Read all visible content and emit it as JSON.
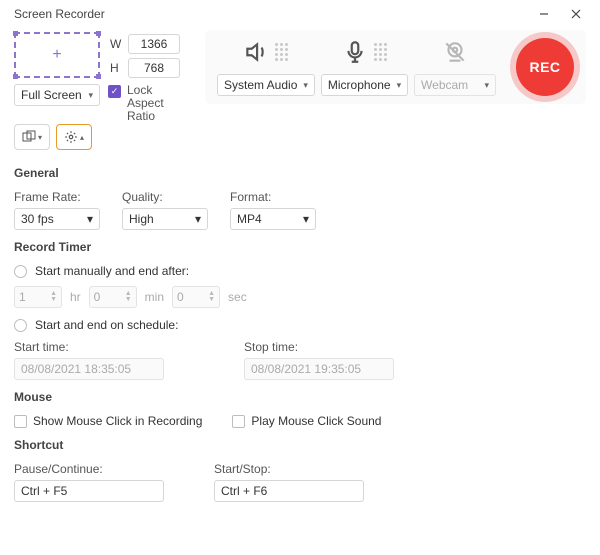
{
  "window": {
    "title": "Screen Recorder"
  },
  "capture": {
    "width": "1366",
    "height": "768",
    "width_label": "W",
    "height_label": "H",
    "mode": "Full Screen",
    "lock_aspect": "Lock Aspect Ratio"
  },
  "devices": {
    "system_audio": "System Audio",
    "microphone": "Microphone",
    "webcam": "Webcam"
  },
  "record_button": "REC",
  "sections": {
    "general": "General",
    "record_timer": "Record Timer",
    "mouse": "Mouse",
    "shortcut": "Shortcut"
  },
  "general": {
    "frame_rate_label": "Frame Rate:",
    "frame_rate_value": "30 fps",
    "quality_label": "Quality:",
    "quality_value": "High",
    "format_label": "Format:",
    "format_value": "MP4"
  },
  "timer": {
    "opt_manual": "Start manually and end after:",
    "opt_schedule": "Start and end on schedule:",
    "hr_value": "1",
    "hr_unit": "hr",
    "min_value": "0",
    "min_unit": "min",
    "sec_value": "0",
    "sec_unit": "sec",
    "start_label": "Start time:",
    "stop_label": "Stop time:",
    "start_value": "08/08/2021 18:35:05",
    "stop_value": "08/08/2021 19:35:05"
  },
  "mouse": {
    "show_click": "Show Mouse Click in Recording",
    "play_sound": "Play Mouse Click Sound"
  },
  "shortcut": {
    "pause_label": "Pause/Continue:",
    "pause_value": "Ctrl + F5",
    "startstop_label": "Start/Stop:",
    "startstop_value": "Ctrl + F6"
  }
}
